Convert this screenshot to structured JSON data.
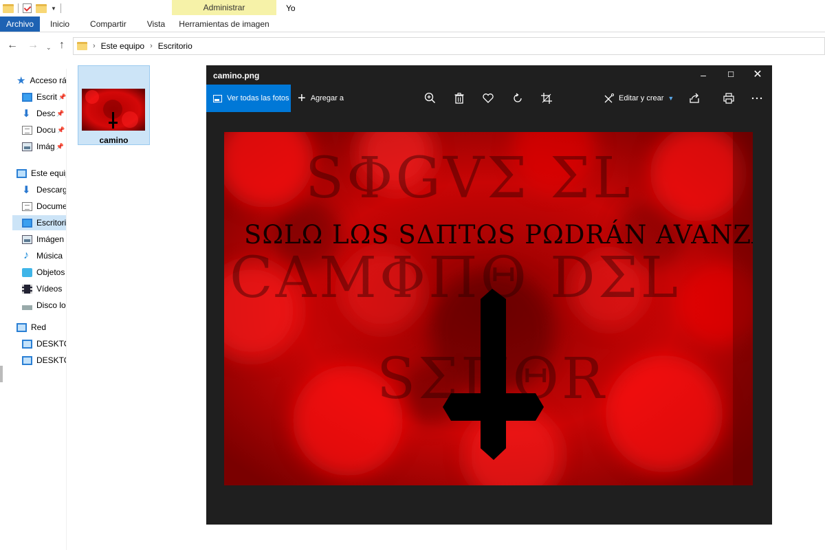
{
  "ribbon": {
    "contextual_group": "Administrar",
    "window_title": "Yo",
    "tabs": [
      "Archivo",
      "Inicio",
      "Compartir",
      "Vista"
    ],
    "contextual_tab": "Herramientas de imagen"
  },
  "address": {
    "segments": [
      "Este equipo",
      "Escritorio"
    ]
  },
  "sidebar": {
    "items": [
      {
        "label": "Acceso rá",
        "icon": "star-icon"
      },
      {
        "label": "Escrit",
        "icon": "desktop-icon",
        "pinned": true
      },
      {
        "label": "Desc",
        "icon": "download-icon",
        "pinned": true
      },
      {
        "label": "Docu",
        "icon": "document-icon",
        "pinned": true
      },
      {
        "label": "Imág",
        "icon": "image-icon",
        "pinned": true
      },
      {
        "label": "Este equip",
        "icon": "pc-icon"
      },
      {
        "label": "Descarg",
        "icon": "download-icon"
      },
      {
        "label": "Docume",
        "icon": "document-icon"
      },
      {
        "label": "Escritori",
        "icon": "desktop-icon",
        "selected": true
      },
      {
        "label": "Imágen",
        "icon": "image-icon"
      },
      {
        "label": "Música",
        "icon": "music-icon"
      },
      {
        "label": "Objetos",
        "icon": "cube-icon"
      },
      {
        "label": "Vídeos",
        "icon": "video-icon"
      },
      {
        "label": "Disco lo",
        "icon": "disk-icon"
      },
      {
        "label": "Red",
        "icon": "network-icon"
      },
      {
        "label": "DESKTO",
        "icon": "computer-icon"
      },
      {
        "label": "DESKTO",
        "icon": "computer-icon"
      }
    ]
  },
  "file": {
    "name": "camino"
  },
  "photos": {
    "title": "camino.png",
    "see_all": "Ver todas las fotos",
    "add_to": "Agregar a",
    "edit_create": "Editar y crear"
  },
  "image": {
    "line1": "SΦGVΣ ΣL",
    "subtitle": "SΩLΩ LΩS SΔΠTΩS PΩDRÁN AVANZAR",
    "line2": "CAMΦΠΘ DΣL",
    "line3": "SΣΠΘR"
  },
  "colors": {
    "ribbon_file_tab": "#1e62b3",
    "contextual_tab": "#f6f2a8",
    "photos_bg": "#1f1f1f",
    "photos_accent": "#0078d7",
    "image_red": "#d00000"
  }
}
